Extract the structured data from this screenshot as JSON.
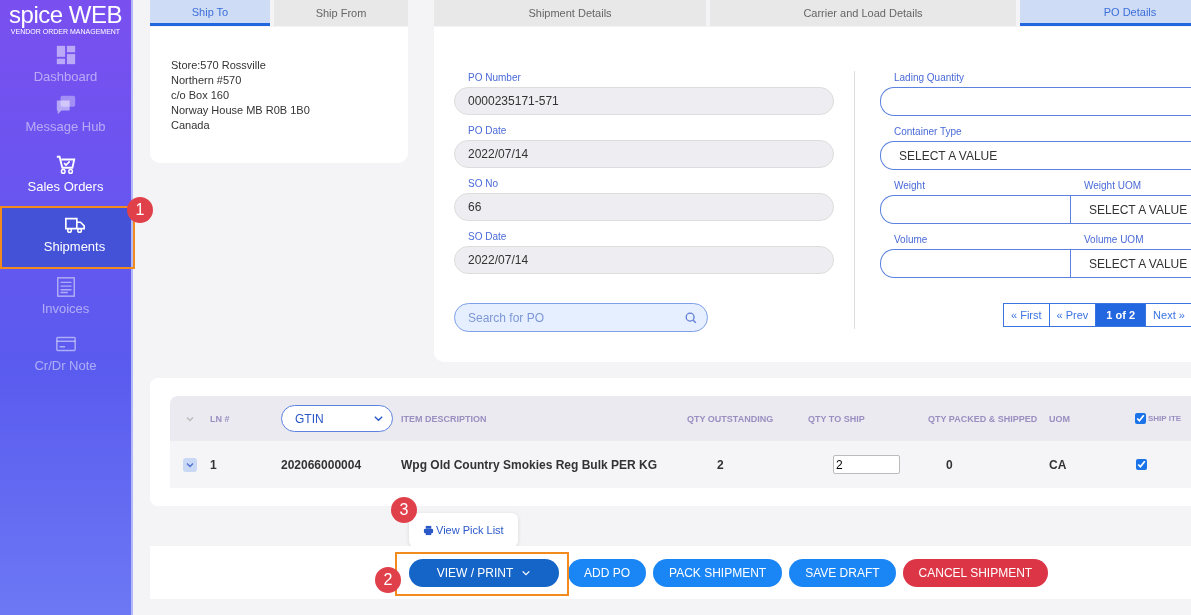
{
  "logo": {
    "wordmark": "spice WEB",
    "tagline": "VENDOR ORDER MANAGEMENT"
  },
  "sidebar": {
    "items": [
      {
        "kind": "dashboard",
        "label": "Dashboard",
        "selected": false,
        "disabled": true
      },
      {
        "kind": "messages",
        "label": "Message Hub",
        "selected": false,
        "disabled": true
      },
      {
        "kind": "cart",
        "label": "Sales Orders",
        "selected": false,
        "disabled": false
      },
      {
        "kind": "truck",
        "label": "Shipments",
        "selected": true,
        "disabled": false
      },
      {
        "kind": "invoice",
        "label": "Invoices",
        "selected": false,
        "disabled": true
      },
      {
        "kind": "card",
        "label": "Cr/Dr Note",
        "selected": false,
        "disabled": true
      }
    ]
  },
  "address_tabs": [
    {
      "label": "Ship To",
      "selected": true
    },
    {
      "label": "Ship From",
      "selected": false
    }
  ],
  "address_lines": [
    "Store:570 Rossville",
    "Northern #570",
    "c/o Box 160",
    "Norway House MB R0B 1B0",
    "Canada"
  ],
  "detail_tabs": [
    {
      "label": "Shipment Details",
      "selected": false
    },
    {
      "label": "Carrier and Load Details",
      "selected": false
    },
    {
      "label": "PO Details",
      "selected": true
    }
  ],
  "po_fields": [
    {
      "label": "PO Number",
      "value": "0000235171-571"
    },
    {
      "label": "PO Date",
      "value": "2022/07/14"
    },
    {
      "label": "SO No",
      "value": "66"
    },
    {
      "label": "SO Date",
      "value": "2022/07/14"
    }
  ],
  "po_search": {
    "placeholder": "Search for PO"
  },
  "load_fields": {
    "lading_quantity": {
      "label": "Lading Quantity"
    },
    "container_type": {
      "label": "Container Type",
      "value": "SELECT A VALUE"
    },
    "weight": {
      "label": "Weight"
    },
    "weight_uom": {
      "label": "Weight UOM",
      "value": "SELECT A VALUE"
    },
    "volume": {
      "label": "Volume"
    },
    "volume_uom": {
      "label": "Volume UOM",
      "value": "SELECT A VALUE"
    }
  },
  "pagination": [
    {
      "label": "« First",
      "selected": false
    },
    {
      "label": "« Prev",
      "selected": false
    },
    {
      "label": "1 of 2",
      "selected": true
    },
    {
      "label": "Next »",
      "selected": false
    }
  ],
  "table": {
    "columns": {
      "ln": "LN #",
      "gtin": "GTIN",
      "description": "ITEM DESCRIPTION",
      "qty_outstanding": "QTY OUTSTANDING",
      "qty_to_ship": "QTY TO SHIP",
      "qty_packed": "QTY PACKED & SHIPPED",
      "uom": "UOM",
      "ship": "SHIP ITE",
      "ship_all_checked": true
    },
    "rows": [
      {
        "ln": "1",
        "gtin": "202066000004",
        "description": "Wpg Old Country Smokies Reg Bulk PER KG",
        "qty_outstanding": "2",
        "qty_to_ship": "2",
        "qty_packed": "0",
        "uom": "CA",
        "ship": true
      }
    ]
  },
  "view_menu": {
    "items": [
      "View Pick List"
    ]
  },
  "actions": [
    {
      "kind": "dropdown",
      "label": "VIEW / PRINT"
    },
    {
      "kind": "primary",
      "label": "ADD PO"
    },
    {
      "kind": "primary",
      "label": "PACK SHIPMENT"
    },
    {
      "kind": "primary",
      "label": "SAVE DRAFT"
    },
    {
      "kind": "danger",
      "label": "CANCEL SHIPMENT"
    }
  ],
  "callouts": [
    "1",
    "2",
    "3"
  ]
}
